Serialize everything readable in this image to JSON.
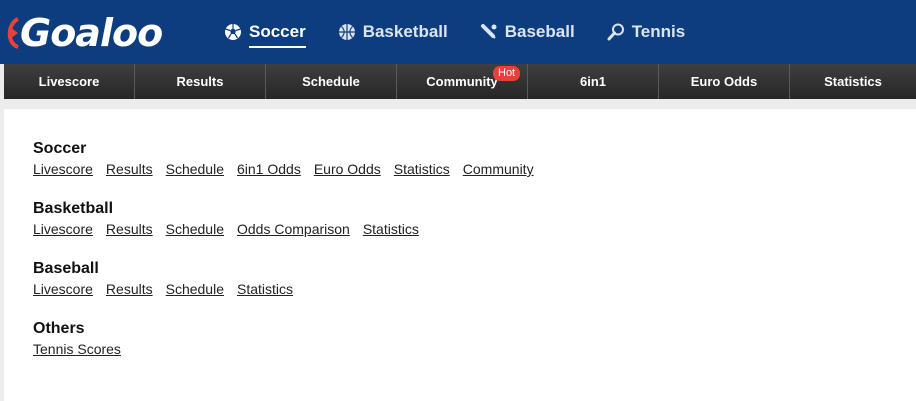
{
  "brand": {
    "logo_text": "Goaloo",
    "accent": "#e8413a",
    "header_bg": "#0d3d7e"
  },
  "sports_nav": [
    {
      "label": "Soccer",
      "icon": "soccer-ball-icon",
      "active": true
    },
    {
      "label": "Basketball",
      "icon": "basketball-icon",
      "active": false
    },
    {
      "label": "Baseball",
      "icon": "baseball-bat-icon",
      "active": false
    },
    {
      "label": "Tennis",
      "icon": "tennis-racket-icon",
      "active": false
    }
  ],
  "subnav": [
    {
      "label": "Livescore"
    },
    {
      "label": "Results"
    },
    {
      "label": "Schedule"
    },
    {
      "label": "Community",
      "badge": "Hot"
    },
    {
      "label": "6in1"
    },
    {
      "label": "Euro Odds"
    },
    {
      "label": "Statistics"
    }
  ],
  "sections": [
    {
      "title": "Soccer",
      "links": [
        "Livescore",
        "Results",
        "Schedule",
        "6in1 Odds",
        "Euro Odds",
        "Statistics",
        "Community"
      ]
    },
    {
      "title": "Basketball",
      "links": [
        "Livescore",
        "Results",
        "Schedule",
        "Odds Comparison",
        "Statistics"
      ]
    },
    {
      "title": "Baseball",
      "links": [
        "Livescore",
        "Results",
        "Schedule",
        "Statistics"
      ]
    },
    {
      "title": "Others",
      "links": [
        "Tennis Scores"
      ]
    }
  ]
}
